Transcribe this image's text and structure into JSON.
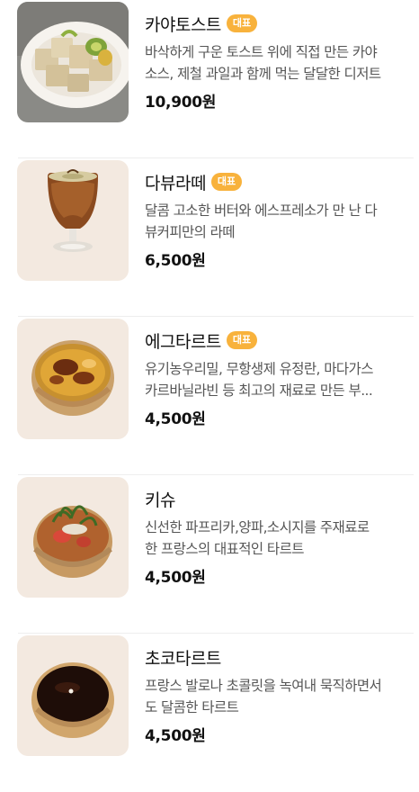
{
  "menu": {
    "items": [
      {
        "name": "카야토스트",
        "badge": "대표",
        "desc_line1": "바삭하게 구운 토스트 위에 직접 만든 카야",
        "desc_line2": "소스, 제철 과일과 함께 먹는 달달한 디저트",
        "price": "10,900원",
        "image": "kaya-toast-plate"
      },
      {
        "name": "다뷰라떼",
        "badge": "대표",
        "desc_line1": "달콤 고소한 버터와 에스프레소가 만 난 다",
        "desc_line2": "뷰커피만의 라떼",
        "price": "6,500원",
        "image": "latte-glass"
      },
      {
        "name": "에그타르트",
        "badge": "대표",
        "desc_line1": "유기농우리밀, 무항생제 유정란, 마다가스",
        "desc_line2": "카르바닐라빈 등 최고의 재료로 만든 부...",
        "price": "4,500원",
        "image": "egg-tart"
      },
      {
        "name": "키슈",
        "badge": "",
        "desc_line1": "신선한 파프리카,양파,소시지를 주재료로",
        "desc_line2": "한 프랑스의 대표적인 타르트",
        "price": "4,500원",
        "image": "quiche"
      },
      {
        "name": "초코타르트",
        "badge": "",
        "desc_line1": "프랑스 발로나 초콜릿을 녹여내 묵직하면서",
        "desc_line2": "도 달콤한 타르트",
        "price": "4,500원",
        "image": "choco-tart"
      }
    ]
  },
  "colors": {
    "badge": "#f8b23c",
    "thumb_bg": "#f3e9e0",
    "divider": "#eeeeee"
  }
}
